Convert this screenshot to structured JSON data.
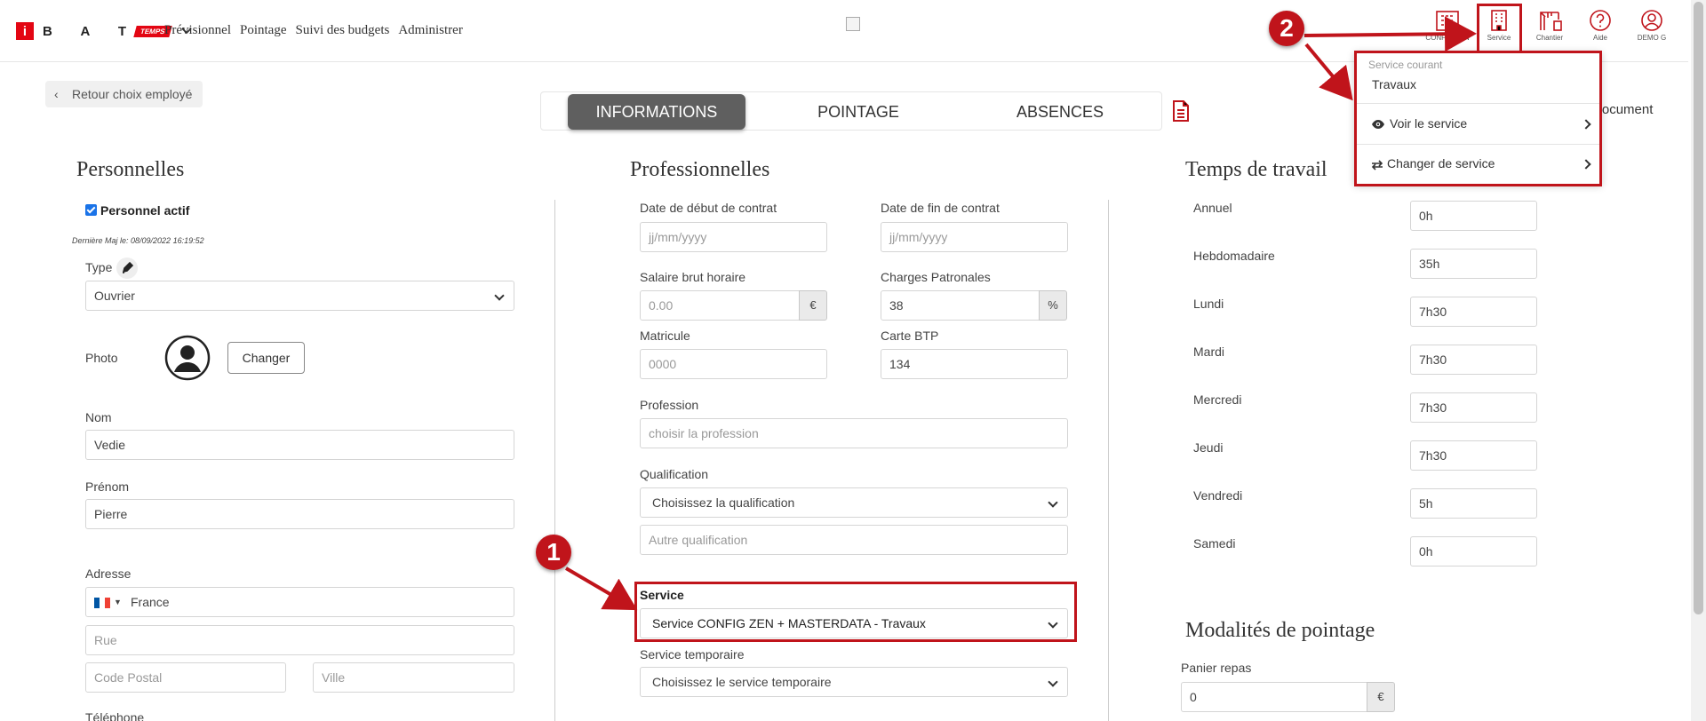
{
  "brand": {
    "letters": "B A T",
    "badge": "TEMPS"
  },
  "nav": [
    "Prévisionnel",
    "Pointage",
    "Suivi des budgets",
    "Administrer"
  ],
  "top_icons": [
    {
      "label": "CONFIG ZEN",
      "icon": "building-grid-icon"
    },
    {
      "label": "Service",
      "icon": "building-icon"
    },
    {
      "label": "Chantier",
      "icon": "crane-icon"
    },
    {
      "label": "Aide",
      "icon": "help-circle-icon"
    },
    {
      "label": "DEMO G",
      "icon": "user-circle-icon"
    }
  ],
  "back_label": "Retour choix employé",
  "tabs": [
    "INFORMATIONS",
    "POINTAGE",
    "ABSENCES"
  ],
  "doc_label": "n document",
  "personnelles": {
    "title": "Personnelles",
    "active_label": "Personnel actif",
    "last_update": "Dernière Maj le: 08/09/2022 16:19:52",
    "type_label": "Type",
    "type_value": "Ouvrier",
    "photo_label": "Photo",
    "change_label": "Changer",
    "nom_label": "Nom",
    "nom_value": "Vedie",
    "prenom_label": "Prénom",
    "prenom_value": "Pierre",
    "adresse_label": "Adresse",
    "country": "France",
    "rue_ph": "Rue",
    "cp_ph": "Code Postal",
    "ville_ph": "Ville",
    "telephone_label": "Téléphone"
  },
  "professionnelles": {
    "title": "Professionnelles",
    "debut_label": "Date de début de contrat",
    "debut_ph": "jj/mm/yyyy",
    "fin_label": "Date de fin de contrat",
    "fin_ph": "jj/mm/yyyy",
    "salaire_label": "Salaire brut horaire",
    "salaire_ph": "0.00",
    "euro": "€",
    "charges_label": "Charges Patronales",
    "charges_value": "38",
    "percent": "%",
    "matricule_label": "Matricule",
    "matricule_ph": "0000",
    "carte_label": "Carte BTP",
    "carte_value": "134",
    "profession_label": "Profession",
    "profession_ph": "choisir la profession",
    "qualif_label": "Qualification",
    "qualif_value": "Choisissez la qualification",
    "autre_ph": "Autre qualification",
    "service_label": "Service",
    "service_value": "Service CONFIG ZEN + MASTERDATA - Travaux",
    "service_temp_label": "Service temporaire",
    "service_temp_value": "Choisissez le service temporaire"
  },
  "temps": {
    "title": "Temps de travail",
    "rows": [
      {
        "label": "Annuel",
        "value": "0h"
      },
      {
        "label": "Hebdomadaire",
        "value": "35h"
      },
      {
        "label": "Lundi",
        "value": "7h30"
      },
      {
        "label": "Mardi",
        "value": "7h30"
      },
      {
        "label": "Mercredi",
        "value": "7h30"
      },
      {
        "label": "Jeudi",
        "value": "7h30"
      },
      {
        "label": "Vendredi",
        "value": "5h"
      },
      {
        "label": "Samedi",
        "value": "0h"
      }
    ]
  },
  "modalites": {
    "title": "Modalités de pointage",
    "panier_label": "Panier repas",
    "panier_value": "0",
    "euro": "€"
  },
  "dropdown": {
    "current_label": "Service courant",
    "current_value": "Travaux",
    "voir_label": "Voir le service",
    "changer_label": "Changer de service"
  },
  "annotations": {
    "one": "1",
    "two": "2"
  },
  "colors": {
    "brand_red": "#e30613",
    "annotation_red": "#c0141b",
    "active_tab": "#5f5f5f"
  }
}
